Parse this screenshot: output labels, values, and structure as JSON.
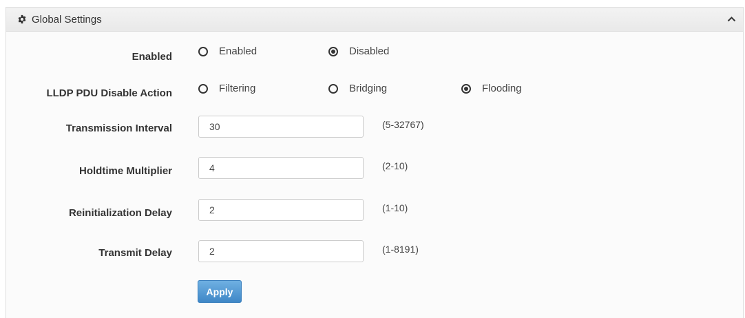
{
  "panel": {
    "title": "Global Settings",
    "header_icon": "gear-icon",
    "collapse_icon": "chevron-up-icon"
  },
  "form": {
    "enabled": {
      "label": "Enabled",
      "options": [
        {
          "label": "Enabled",
          "checked": false
        },
        {
          "label": "Disabled",
          "checked": true
        }
      ]
    },
    "pdu_action": {
      "label": "LLDP PDU Disable Action",
      "options": [
        {
          "label": "Filtering",
          "checked": false
        },
        {
          "label": "Bridging",
          "checked": false
        },
        {
          "label": "Flooding",
          "checked": true
        }
      ]
    },
    "fields": [
      {
        "label": "Transmission Interval",
        "value": "30",
        "range": "(5-32767)"
      },
      {
        "label": "Holdtime Multiplier",
        "value": "4",
        "range": "(2-10)"
      },
      {
        "label": "Reinitialization Delay",
        "value": "2",
        "range": "(1-10)"
      },
      {
        "label": "Transmit Delay",
        "value": "2",
        "range": "(1-8191)"
      }
    ],
    "apply_label": "Apply"
  },
  "colors": {
    "button": "#4a90d0",
    "header": "#eeeeee"
  }
}
